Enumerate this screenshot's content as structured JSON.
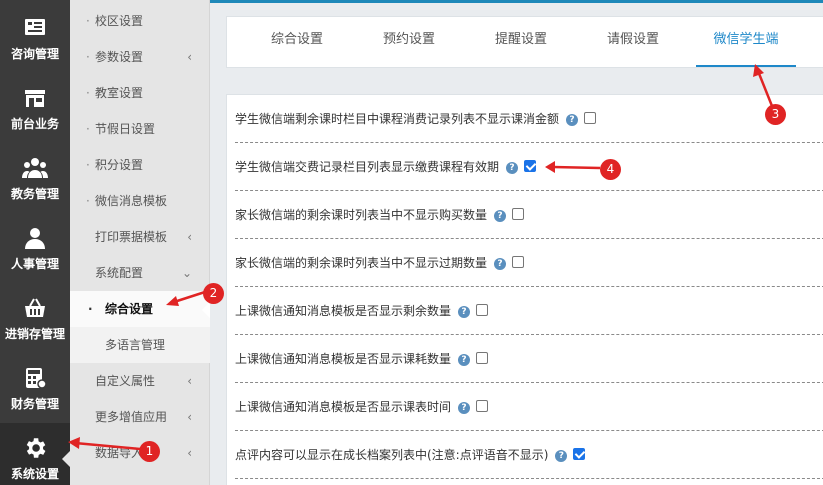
{
  "rail": {
    "items": [
      {
        "label": "咨询管理",
        "icon": "consult-icon"
      },
      {
        "label": "前台业务",
        "icon": "store-icon"
      },
      {
        "label": "教务管理",
        "icon": "people-icon"
      },
      {
        "label": "人事管理",
        "icon": "person-icon"
      },
      {
        "label": "进销存管理",
        "icon": "basket-icon"
      },
      {
        "label": "财务管理",
        "icon": "calculator-icon"
      },
      {
        "label": "系统设置",
        "icon": "gear-icon"
      }
    ]
  },
  "submenu": {
    "items": [
      {
        "label": "校区设置"
      },
      {
        "label": "参数设置"
      },
      {
        "label": "教室设置"
      },
      {
        "label": "节假日设置"
      },
      {
        "label": "积分设置"
      },
      {
        "label": "微信消息模板"
      },
      {
        "label": "打印票据模板"
      },
      {
        "label": "系统配置"
      },
      {
        "label": "自定义属性"
      },
      {
        "label": "更多增值应用"
      },
      {
        "label": "数据导入"
      }
    ],
    "children": [
      {
        "label": "综合设置"
      },
      {
        "label": "多语言管理"
      }
    ]
  },
  "tabs": [
    {
      "label": "综合设置"
    },
    {
      "label": "预约设置"
    },
    {
      "label": "提醒设置"
    },
    {
      "label": "请假设置"
    },
    {
      "label": "微信学生端"
    }
  ],
  "settings": [
    {
      "label": "学生微信端剩余课时栏目中课程消费记录列表不显示课消金额",
      "checked": false
    },
    {
      "label": "学生微信端交费记录栏目列表显示缴费课程有效期",
      "checked": true
    },
    {
      "label": "家长微信端的剩余课时列表当中不显示购买数量",
      "checked": false
    },
    {
      "label": "家长微信端的剩余课时列表当中不显示过期数量",
      "checked": false
    },
    {
      "label": "上课微信通知消息模板是否显示剩余数量",
      "checked": false
    },
    {
      "label": "上课微信通知消息模板是否显示课耗数量",
      "checked": false
    },
    {
      "label": "上课微信通知消息模板是否显示课表时间",
      "checked": false
    },
    {
      "label": "点评内容可以显示在成长档案列表中(注意:点评语音不显示)",
      "checked": true
    }
  ],
  "help_glyph": "?",
  "annotations": [
    "1",
    "2",
    "3",
    "4"
  ],
  "colors": {
    "accent": "#1e88c9",
    "annotation": "#e02424",
    "rail": "#3b3b3b",
    "checkbox_checked": "#1a73e8"
  }
}
